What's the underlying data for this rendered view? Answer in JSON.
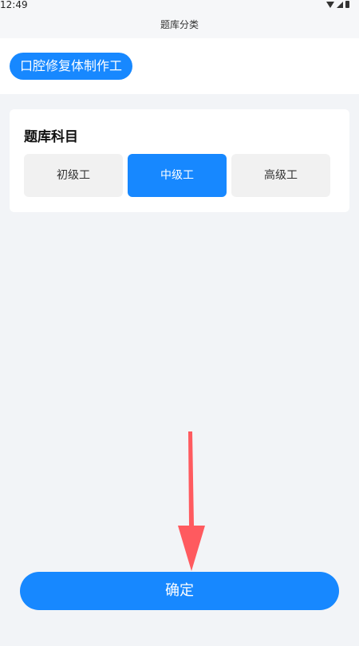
{
  "status_bar": {
    "time": "12:49"
  },
  "header": {
    "title": "题库分类"
  },
  "category": {
    "selected_label": "口腔修复体制作工"
  },
  "subject": {
    "title": "题库科目",
    "levels": [
      {
        "label": "初级工"
      },
      {
        "label": "中级工"
      },
      {
        "label": "高级工"
      }
    ],
    "selected_level": "中级工"
  },
  "actions": {
    "confirm_label": "确定"
  },
  "colors": {
    "accent": "#1788ff",
    "annotation_arrow": "#ff5a5f"
  }
}
